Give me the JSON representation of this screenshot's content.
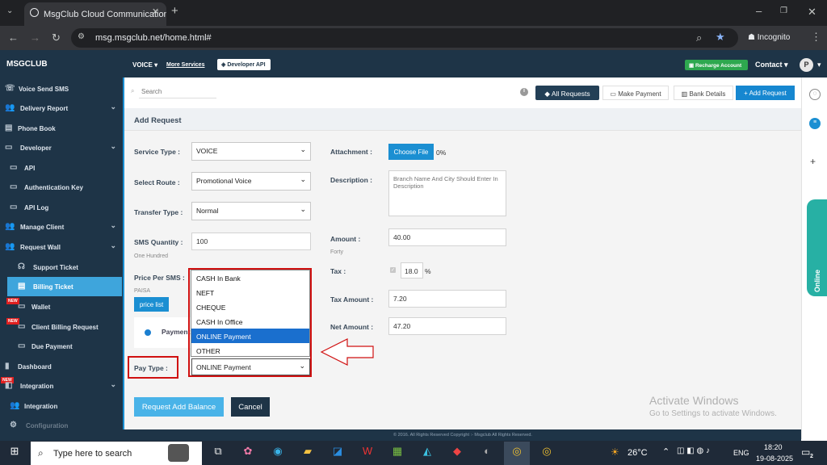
{
  "browser": {
    "tab_title": "MsgClub Cloud Communication",
    "url": "msg.msgclub.net/home.html#",
    "profile": "Incognito"
  },
  "header": {
    "brand": "MSGCLUB",
    "voice_menu": "VOICE",
    "more_services": "More Services",
    "dev_api": "Developer API",
    "recharge": "Recharge Account",
    "contact": "Contact",
    "avatar_initial": "P"
  },
  "sidebar": {
    "items": [
      {
        "label": "Voice Send SMS"
      },
      {
        "label": "Delivery Report"
      },
      {
        "label": "Phone Book"
      },
      {
        "label": "Developer"
      },
      {
        "label": "API"
      },
      {
        "label": "Authentication Key"
      },
      {
        "label": "API Log"
      },
      {
        "label": "Manage Client"
      },
      {
        "label": "Request Wall"
      },
      {
        "label": "Support Ticket"
      },
      {
        "label": "Billing Ticket"
      },
      {
        "label": "Wallet"
      },
      {
        "label": "Client Billing Request"
      },
      {
        "label": "Due Payment"
      },
      {
        "label": "Dashboard"
      },
      {
        "label": "Integration"
      },
      {
        "label": "Integration"
      },
      {
        "label": "Configuration"
      }
    ],
    "new_badge": "NEW"
  },
  "toolbar": {
    "search_placeholder": "Search",
    "all_requests": "All Requests",
    "make_payment": "Make Payment",
    "bank_details": "Bank Details",
    "add_request": "Add Request"
  },
  "form": {
    "title": "Add Request",
    "service_type_label": "Service Type :",
    "service_type_value": "VOICE",
    "route_label": "Select Route :",
    "route_value": "Promotional Voice",
    "transfer_label": "Transfer Type :",
    "transfer_value": "Normal",
    "sms_qty_label": "SMS Quantity :",
    "sms_qty_value": "100",
    "sms_qty_words": "One Hundred",
    "price_label": "Price Per SMS :",
    "price_unit": "PAISA",
    "price_list": "price list",
    "payment_partial": "Payment",
    "pay_type_label": "Pay Type :",
    "pay_type_value": "ONLINE Payment",
    "pay_options": [
      "CASH In Bank",
      "NEFT",
      "CHEQUE",
      "CASH In Office",
      "ONLINE Payment",
      "OTHER"
    ],
    "attachment_label": "Attachment :",
    "choose_file": "Choose File",
    "file_progress": "0%",
    "description_label": "Description :",
    "description_placeholder": "Branch Name And City Should Enter In Description",
    "amount_label": "Amount :",
    "amount_value": "40.00",
    "amount_words": "Forty",
    "tax_label": "Tax :",
    "tax_value": "18.0",
    "tax_pct": "%",
    "tax_amount_label": "Tax Amount :",
    "tax_amount_value": "7.20",
    "net_amount_label": "Net Amount :",
    "net_amount_value": "47.20",
    "submit": "Request Add Balance",
    "cancel": "Cancel"
  },
  "footer": "© 2016. All Rights Reserved Copyright :- Msgclub All Rights Reserved.",
  "right_panel": {
    "online": "Online"
  },
  "watermark": {
    "line1": "Activate Windows",
    "line2": "Go to Settings to activate Windows."
  },
  "taskbar": {
    "search": "Type here to search",
    "temp": "26°C",
    "lang": "ENG",
    "time": "18:20",
    "date": "19-08-2025",
    "notif_count": "2"
  }
}
